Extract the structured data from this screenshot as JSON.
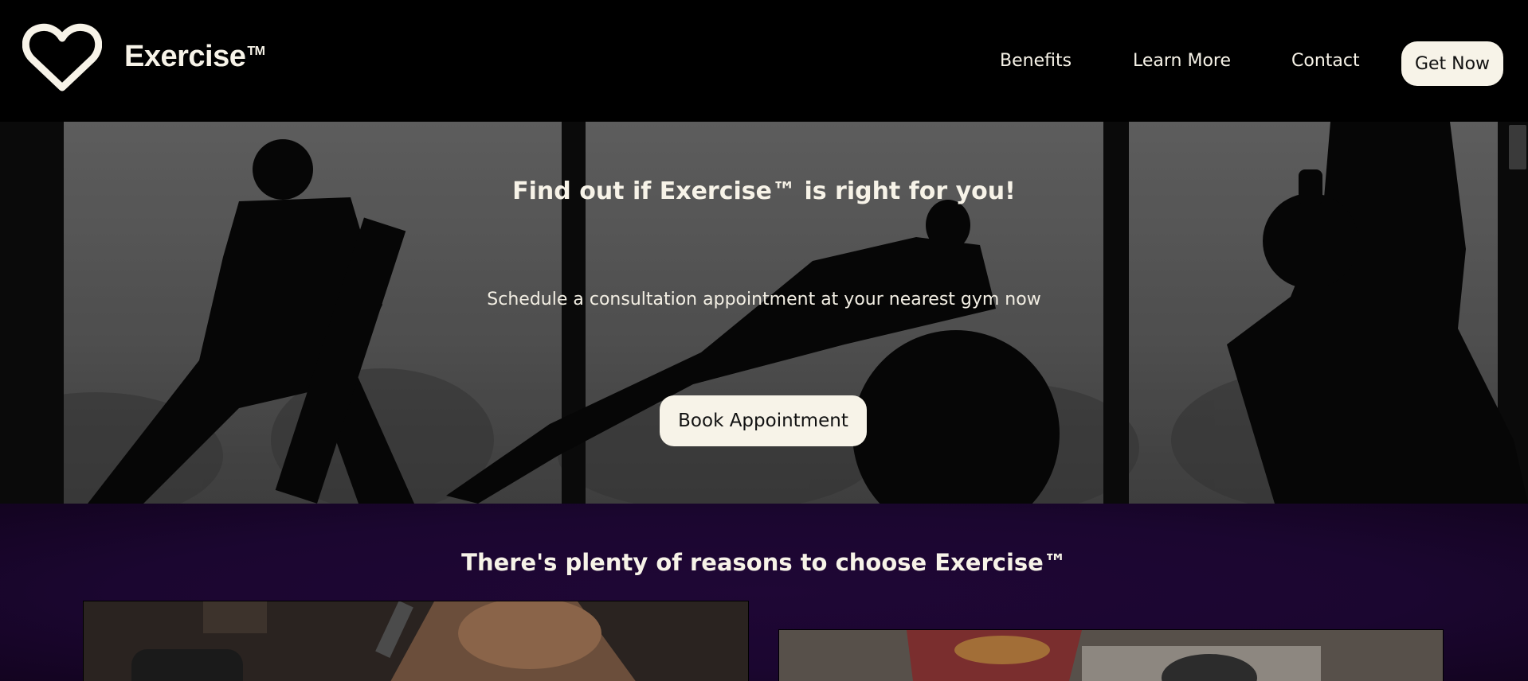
{
  "brand": {
    "name": "Exercise",
    "trademark": "TM",
    "logo_icon": "heart-outline-icon"
  },
  "nav": {
    "items": [
      {
        "label": "Benefits"
      },
      {
        "label": "Learn More"
      },
      {
        "label": "Contact"
      }
    ],
    "cta_label": "Get Now"
  },
  "hero": {
    "title": "Find out if Exercise™ is right for you!",
    "subtitle": "Schedule a consultation appointment at your nearest gym now",
    "button_label": "Book Appointment"
  },
  "reasons": {
    "title": "There's plenty of reasons to choose Exercise™"
  },
  "colors": {
    "header_bg": "#000000",
    "cream": "#f7f3e8",
    "section_purple": "#1f0735"
  }
}
